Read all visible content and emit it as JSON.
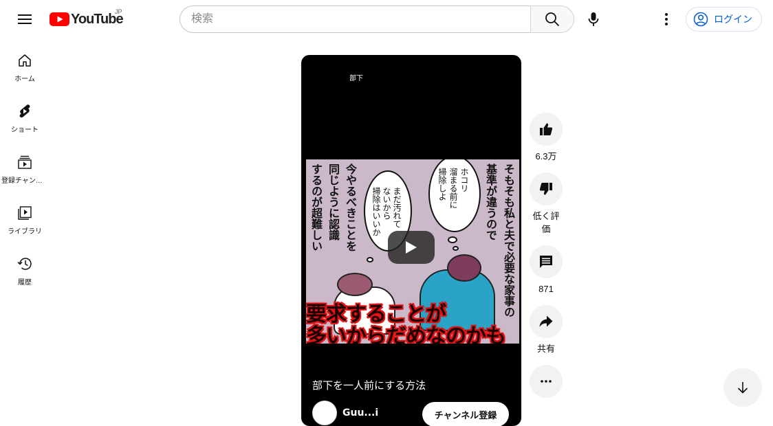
{
  "header": {
    "logo_text": "YouTube",
    "region": "JP",
    "search_placeholder": "検索",
    "signin_label": "ログイン"
  },
  "guide": {
    "items": [
      {
        "label": "ホーム",
        "icon": "home-icon"
      },
      {
        "label": "ショート",
        "icon": "shorts-icon"
      },
      {
        "label": "登録チャンネル",
        "icon": "subscriptions-icon"
      },
      {
        "label": "ライブラリ",
        "icon": "library-icon"
      },
      {
        "label": "履歴",
        "icon": "history-icon"
      }
    ]
  },
  "short": {
    "top_caption": "部下",
    "manga_lines": [
      "そもそも私と夫で必要な家事の",
      "基準が違うので",
      "今やるべきことを",
      "同じように認識",
      "するのが超難しい"
    ],
    "bubble_left": [
      "ホコリ",
      "溜まる前に",
      "掃除しよ"
    ],
    "bubble_right": [
      "まだ汚れて",
      "ないから",
      "掃除はいいか"
    ],
    "overlay_line1": "要求することが",
    "overlay_line2": "多いからだめなのかも",
    "title": "部下を一人前にする方法",
    "channel_name": "Guu...i",
    "subscribe_label": "チャンネル登録"
  },
  "actions": {
    "like_count": "6.3万",
    "dislike_label": "低く評価",
    "comment_count": "871",
    "share_label": "共有"
  },
  "colors": {
    "brand_red": "#ff0000",
    "link_blue": "#065fd4",
    "button_gray": "#f2f2f2"
  }
}
